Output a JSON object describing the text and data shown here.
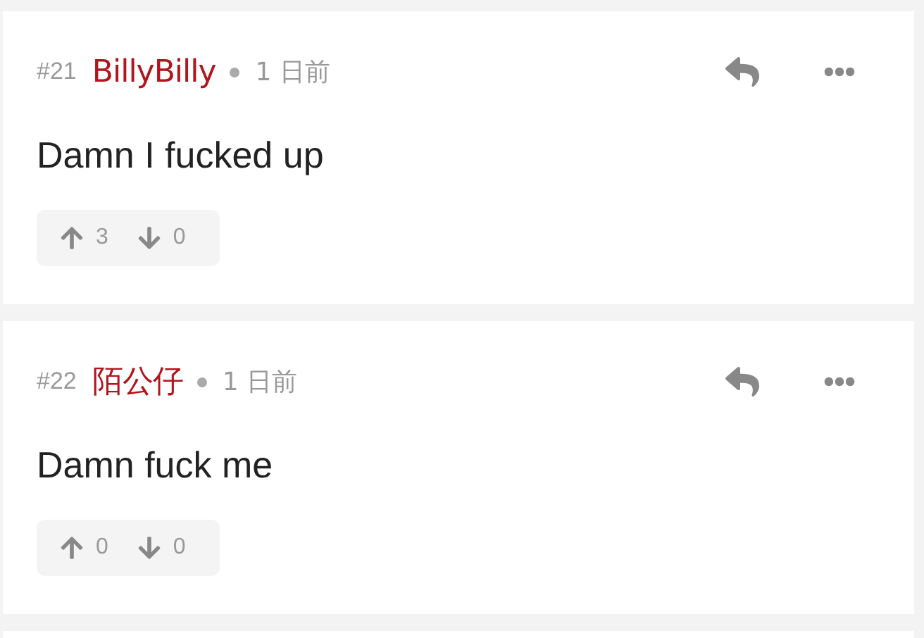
{
  "comments": [
    {
      "number": "#21",
      "author": "BillyBilly",
      "time": "1 日前",
      "body": "Damn I fucked up",
      "upvotes": "3",
      "downvotes": "0"
    },
    {
      "number": "#22",
      "author": "陌公仔",
      "time": "1 日前",
      "body": "Damn fuck me",
      "upvotes": "0",
      "downvotes": "0"
    }
  ]
}
